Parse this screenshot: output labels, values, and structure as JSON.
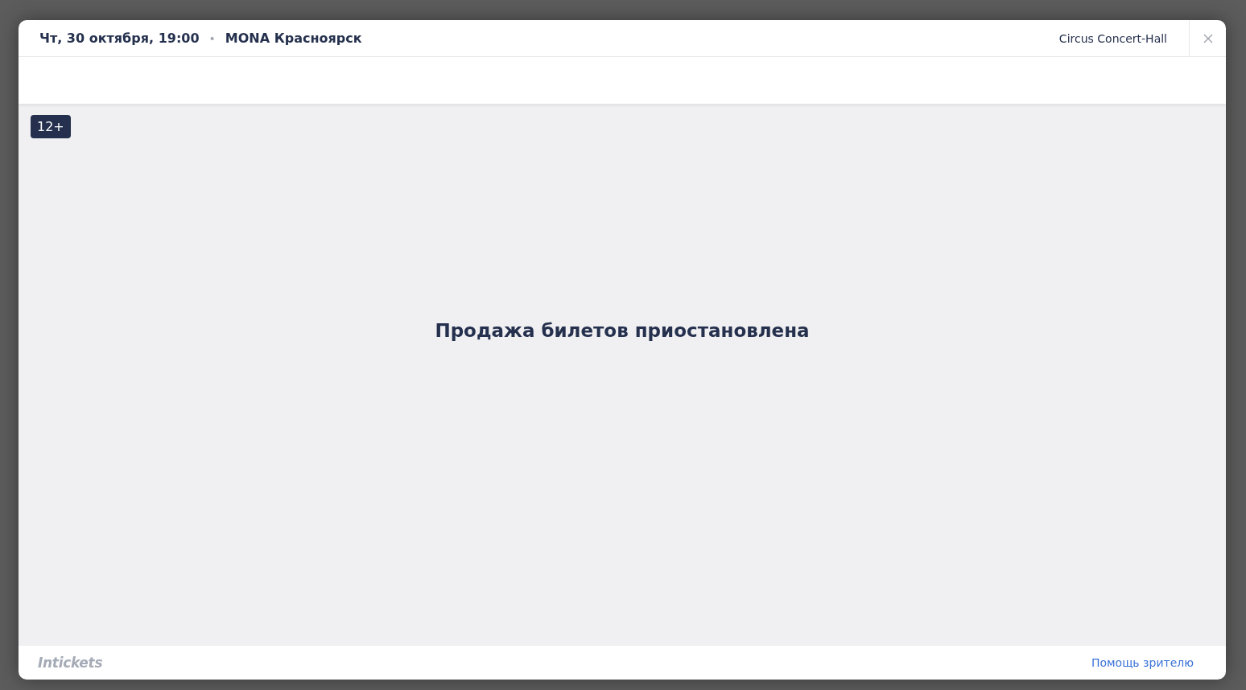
{
  "header": {
    "date": "Чт, 30 октября, 19:00",
    "separator": "•",
    "event": "MONA Красноярск",
    "venue": "Circus Concert-Hall"
  },
  "age_badge": "12+",
  "message": "Продажа билетов приостановлена",
  "footer": {
    "brand": "Intickets",
    "help_link": "Помощь зрителю"
  }
}
